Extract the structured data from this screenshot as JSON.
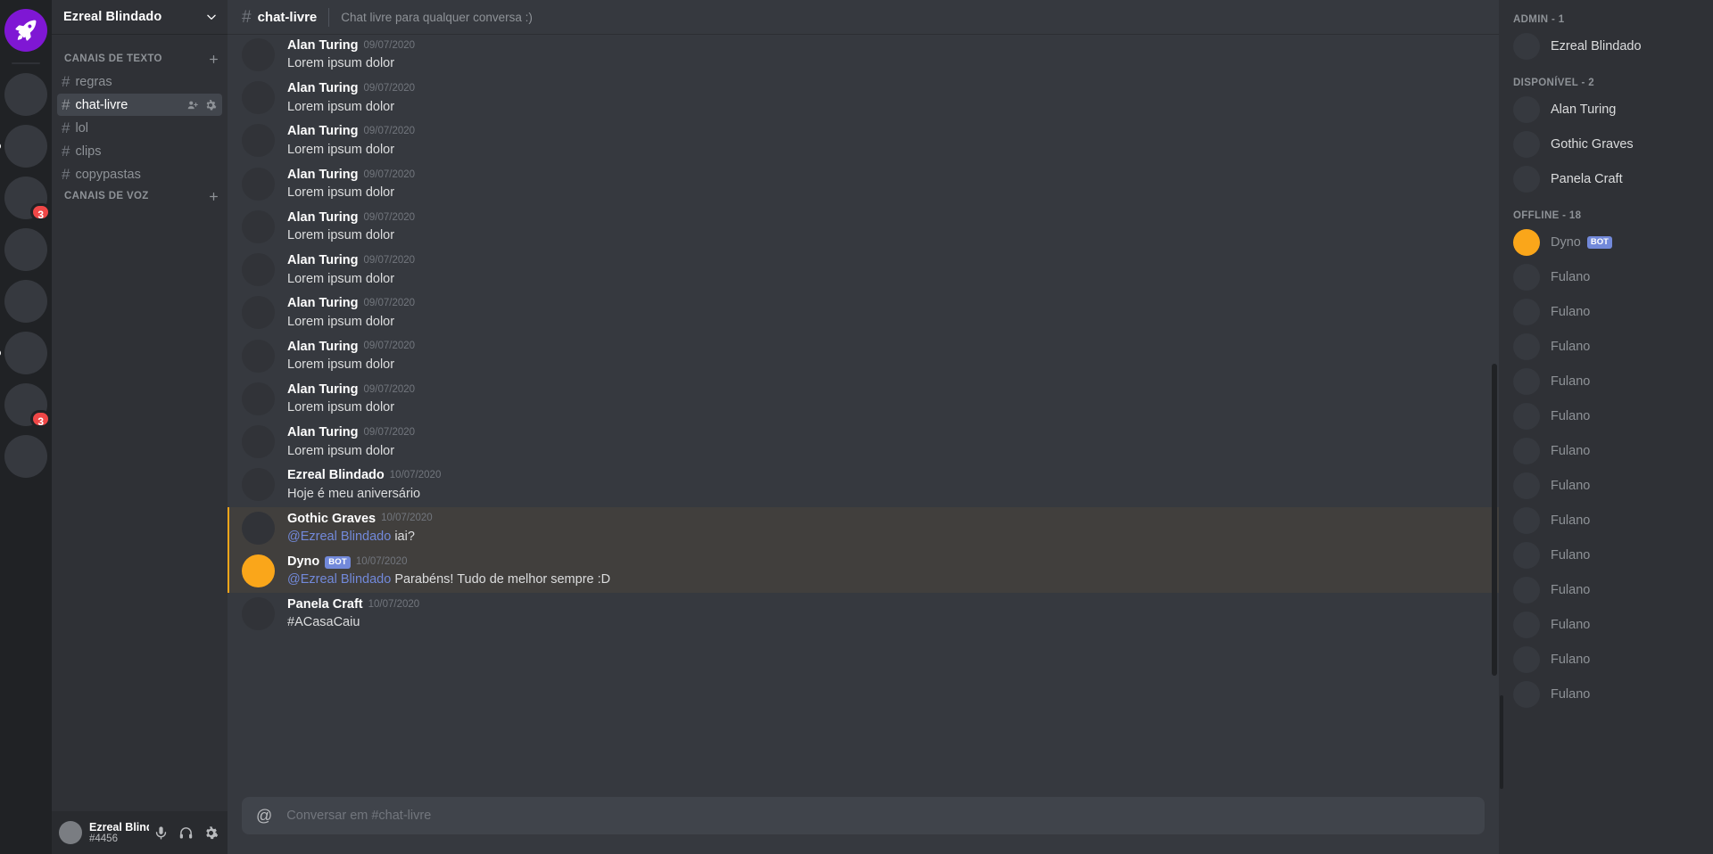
{
  "rail": {
    "home": {
      "name": "Ezreal Blindado",
      "icon": "rocket-icon",
      "color": "#7f17d4"
    },
    "servers": [
      {
        "badge": "",
        "active": false,
        "unread": false
      },
      {
        "badge": "",
        "active": false,
        "unread": true
      },
      {
        "badge": "3",
        "active": false,
        "unread": false
      },
      {
        "badge": "",
        "active": false,
        "unread": false
      },
      {
        "badge": "",
        "active": false,
        "unread": false
      },
      {
        "badge": "",
        "active": false,
        "unread": true
      },
      {
        "badge": "3",
        "active": false,
        "unread": false
      },
      {
        "badge": "",
        "active": false,
        "unread": false
      }
    ]
  },
  "sidebar": {
    "guild_name": "Ezreal Blindado",
    "categories": [
      {
        "label": "CANAIS DE TEXTO",
        "add_label": "+",
        "channels": [
          {
            "name": "regras",
            "active": false
          },
          {
            "name": "chat-livre",
            "active": true
          },
          {
            "name": "lol",
            "active": false
          },
          {
            "name": "clips",
            "active": false
          },
          {
            "name": "copypastas",
            "active": false
          }
        ]
      },
      {
        "label": "CANAIS DE VOZ",
        "add_label": "+",
        "channels": []
      }
    ]
  },
  "user_panel": {
    "name": "Ezreal Blindado",
    "tag": "#4456",
    "icons": [
      "microphone-icon",
      "headphones-icon",
      "gear-icon"
    ]
  },
  "chat_header": {
    "hash": "#",
    "channel": "chat-livre",
    "topic": "Chat livre para qualquer conversa :)"
  },
  "messages": [
    {
      "author": "Alan Turing",
      "timestamp": "09/07/2020",
      "text": "Lorem ipsum dolor",
      "bot": false,
      "mention": false,
      "avatar_color": ""
    },
    {
      "author": "Alan Turing",
      "timestamp": "09/07/2020",
      "text": "Lorem ipsum dolor",
      "bot": false,
      "mention": false,
      "avatar_color": ""
    },
    {
      "author": "Alan Turing",
      "timestamp": "09/07/2020",
      "text": "Lorem ipsum dolor",
      "bot": false,
      "mention": false,
      "avatar_color": ""
    },
    {
      "author": "Alan Turing",
      "timestamp": "09/07/2020",
      "text": "Lorem ipsum dolor",
      "bot": false,
      "mention": false,
      "avatar_color": ""
    },
    {
      "author": "Alan Turing",
      "timestamp": "09/07/2020",
      "text": "Lorem ipsum dolor",
      "bot": false,
      "mention": false,
      "avatar_color": ""
    },
    {
      "author": "Alan Turing",
      "timestamp": "09/07/2020",
      "text": "Lorem ipsum dolor",
      "bot": false,
      "mention": false,
      "avatar_color": ""
    },
    {
      "author": "Alan Turing",
      "timestamp": "09/07/2020",
      "text": "Lorem ipsum dolor",
      "bot": false,
      "mention": false,
      "avatar_color": ""
    },
    {
      "author": "Alan Turing",
      "timestamp": "09/07/2020",
      "text": "Lorem ipsum dolor",
      "bot": false,
      "mention": false,
      "avatar_color": ""
    },
    {
      "author": "Alan Turing",
      "timestamp": "09/07/2020",
      "text": "Lorem ipsum dolor",
      "bot": false,
      "mention": false,
      "avatar_color": ""
    },
    {
      "author": "Alan Turing",
      "timestamp": "09/07/2020",
      "text": "Lorem ipsum dolor",
      "bot": false,
      "mention": false,
      "avatar_color": ""
    },
    {
      "author": "Ezreal Blindado",
      "timestamp": "10/07/2020",
      "text": "Hoje é meu aniversário",
      "bot": false,
      "mention": false,
      "avatar_color": ""
    },
    {
      "author": "Gothic Graves",
      "timestamp": "10/07/2020",
      "mention_prefix": "@Ezreal Blindado",
      "text": " iai?",
      "bot": false,
      "mention": true,
      "avatar_color": ""
    },
    {
      "author": "Dyno",
      "timestamp": "10/07/2020",
      "mention_prefix": "@Ezreal Blindado",
      "text": " Parabéns! Tudo de melhor sempre :D",
      "bot": true,
      "bot_label": "BOT",
      "mention": true,
      "avatar_color": "#faa61a"
    },
    {
      "author": "Panela Craft",
      "timestamp": "10/07/2020",
      "text": "#ACasaCaiu",
      "bot": false,
      "mention": false,
      "avatar_color": ""
    }
  ],
  "composer": {
    "icon": "at-icon",
    "placeholder": "Conversar em #chat-livre",
    "value": ""
  },
  "members": {
    "groups": [
      {
        "label": "ADMIN - 1",
        "people": [
          {
            "name": "Ezreal Blindado",
            "online": true,
            "bot": false,
            "avatar_color": ""
          }
        ]
      },
      {
        "label": "DISPONÍVEL - 2",
        "people": [
          {
            "name": "Alan Turing",
            "online": true,
            "bot": false,
            "avatar_color": ""
          },
          {
            "name": "Gothic Graves",
            "online": true,
            "bot": false,
            "avatar_color": ""
          },
          {
            "name": "Panela Craft",
            "online": true,
            "bot": false,
            "avatar_color": ""
          }
        ]
      },
      {
        "label": "OFFLINE - 18",
        "people": [
          {
            "name": "Dyno",
            "online": false,
            "bot": true,
            "bot_label": "BOT",
            "avatar_color": "#faa61a"
          },
          {
            "name": "Fulano",
            "online": false,
            "bot": false,
            "avatar_color": ""
          },
          {
            "name": "Fulano",
            "online": false,
            "bot": false,
            "avatar_color": ""
          },
          {
            "name": "Fulano",
            "online": false,
            "bot": false,
            "avatar_color": ""
          },
          {
            "name": "Fulano",
            "online": false,
            "bot": false,
            "avatar_color": ""
          },
          {
            "name": "Fulano",
            "online": false,
            "bot": false,
            "avatar_color": ""
          },
          {
            "name": "Fulano",
            "online": false,
            "bot": false,
            "avatar_color": ""
          },
          {
            "name": "Fulano",
            "online": false,
            "bot": false,
            "avatar_color": ""
          },
          {
            "name": "Fulano",
            "online": false,
            "bot": false,
            "avatar_color": ""
          },
          {
            "name": "Fulano",
            "online": false,
            "bot": false,
            "avatar_color": ""
          },
          {
            "name": "Fulano",
            "online": false,
            "bot": false,
            "avatar_color": ""
          },
          {
            "name": "Fulano",
            "online": false,
            "bot": false,
            "avatar_color": ""
          },
          {
            "name": "Fulano",
            "online": false,
            "bot": false,
            "avatar_color": ""
          },
          {
            "name": "Fulano",
            "online": false,
            "bot": false,
            "avatar_color": ""
          }
        ]
      }
    ]
  },
  "colors": {
    "brand_purple": "#7f17d4",
    "mention_blue": "#7289da",
    "bot_orange": "#faa61a",
    "badge_red": "#f04747"
  }
}
